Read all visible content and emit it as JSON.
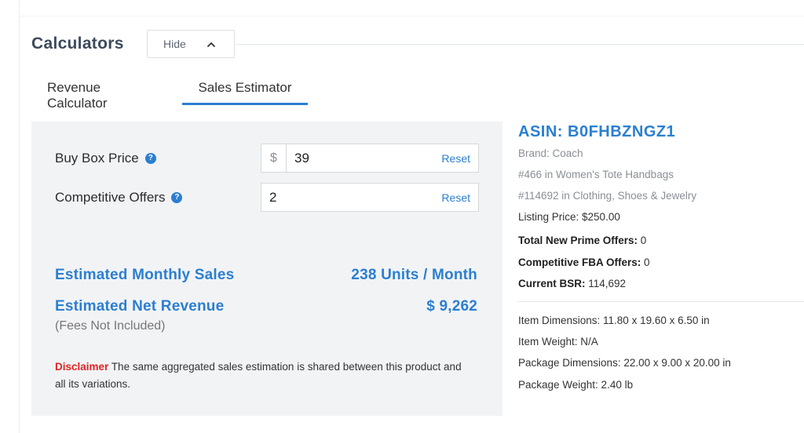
{
  "header": {
    "title": "Calculators",
    "hide_label": "Hide"
  },
  "tabs": [
    {
      "label": "Revenue Calculator",
      "active": false
    },
    {
      "label": "Sales Estimator",
      "active": true
    }
  ],
  "calculator": {
    "buy_box": {
      "label": "Buy Box Price",
      "currency": "$",
      "value": "39",
      "reset_label": "Reset"
    },
    "offers": {
      "label": "Competitive Offers",
      "value": "2",
      "reset_label": "Reset"
    },
    "monthly_sales": {
      "label": "Estimated Monthly Sales",
      "value": "238 Units / Month"
    },
    "net_revenue": {
      "label": "Estimated Net Revenue",
      "value": "$ 9,262",
      "note": "(Fees Not Included)"
    },
    "disclaimer": {
      "label": "Disclaimer",
      "text": "The same aggregated sales estimation is shared between this product and all its variations."
    }
  },
  "product": {
    "asin": "ASIN: B0FHBZNGZ1",
    "brand": "Brand: Coach",
    "rank_1": "#466 in Women's Tote Handbags",
    "rank_2": "#114692 in Clothing, Shoes & Jewelry",
    "listing_price": "Listing Price: $250.00",
    "prime_offers": {
      "label": "Total New Prime Offers:",
      "value": " 0"
    },
    "fba_offers": {
      "label": "Competitive FBA Offers:",
      "value": " 0"
    },
    "bsr": {
      "label": "Current BSR:",
      "value": " 114,692"
    },
    "item_dimensions": "Item Dimensions: 11.80 x 19.60 x 6.50 in",
    "item_weight": "Item Weight: N/A",
    "package_dimensions": "Package Dimensions: 22.00 x 9.00 x 20.00 in",
    "package_weight": "Package Weight: 2.40 lb"
  },
  "colors": {
    "accent": "#2b7fd1",
    "panel_bg": "#f2f3f5",
    "disclaimer_red": "#e02424",
    "title_slate": "#3d4a5c"
  },
  "icons": {
    "help": "question-circle-icon",
    "collapse": "chevron-up-icon"
  }
}
